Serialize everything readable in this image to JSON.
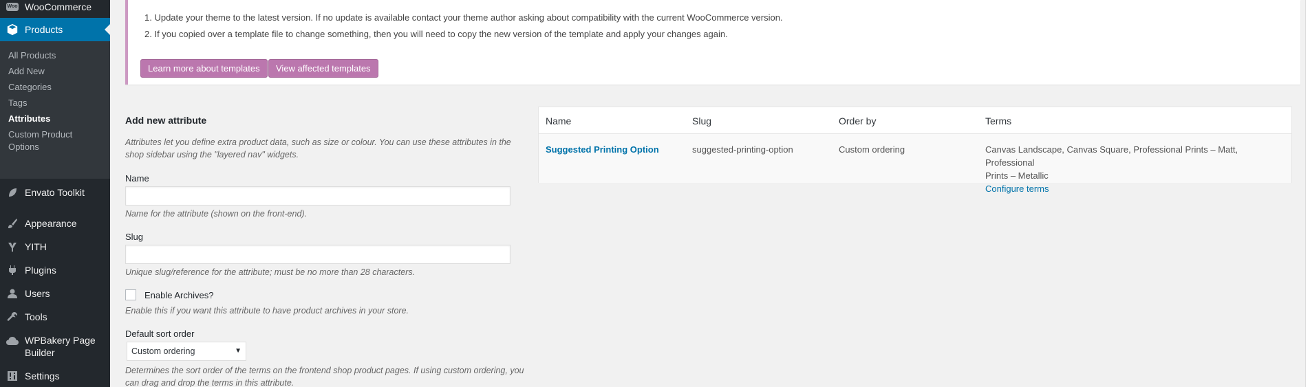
{
  "sidebar": {
    "woocommerce": "WooCommerce",
    "woo_badge": "Woo",
    "products": "Products",
    "submenu": [
      "All Products",
      "Add New",
      "Categories",
      "Tags",
      "Attributes",
      "Custom Product",
      "Options"
    ],
    "items": [
      "Envato Toolkit",
      "Appearance",
      "YITH",
      "Plugins",
      "Users",
      "Tools",
      "WPBakery Page",
      "Builder",
      "Settings"
    ]
  },
  "notice": {
    "line1": "1. Update your theme to the latest version. If no update is available contact your theme author asking about compatibility with the current WooCommerce version.",
    "line2": "2. If you copied over a template file to change something, then you will need to copy the new version of the template and apply your changes again.",
    "btn_learn": "Learn more about templates",
    "btn_view": "View affected templates"
  },
  "form": {
    "heading": "Add new attribute",
    "intro1": "Attributes let you define extra product data, such as size or colour. You can use these attributes in the",
    "intro2": "shop sidebar using the \"layered nav\" widgets.",
    "name_label": "Name",
    "name_value": "",
    "name_desc": "Name for the attribute (shown on the front-end).",
    "slug_label": "Slug",
    "slug_value": "",
    "slug_desc": "Unique slug/reference for the attribute; must be no more than 28 characters.",
    "archives_label": "Enable Archives?",
    "archives_checked": false,
    "archives_desc": "Enable this if you want this attribute to have product archives in your store.",
    "sort_label": "Default sort order",
    "sort_value": "Custom ordering",
    "sort_desc1": "Determines the sort order of the terms on the frontend shop product pages. If using custom ordering, you",
    "sort_desc2": "can drag and drop the terms in this attribute."
  },
  "table": {
    "headers": [
      "Name",
      "Slug",
      "Order by",
      "Terms"
    ],
    "row": {
      "name": "Suggested Printing Option",
      "slug": "suggested-printing-option",
      "order_by": "Custom ordering",
      "terms1": "Canvas Landscape, Canvas Square, Professional Prints – Matt, Professional",
      "terms2": "Prints – Metallic",
      "configure": "Configure terms"
    }
  },
  "icons": {
    "woo": "woo-icon",
    "products": "cube-icon",
    "envato": "leaf-icon",
    "appearance": "brush-icon",
    "yith": "yith-icon",
    "plugins": "plug-icon",
    "users": "user-icon",
    "tools": "wrench-icon",
    "wpbakery": "cloud-icon",
    "settings": "settings-icon"
  },
  "colors": {
    "sidebar_bg": "#23282d",
    "active": "#0073aa",
    "woo_button": "#bb77ae",
    "link": "#0073aa"
  }
}
